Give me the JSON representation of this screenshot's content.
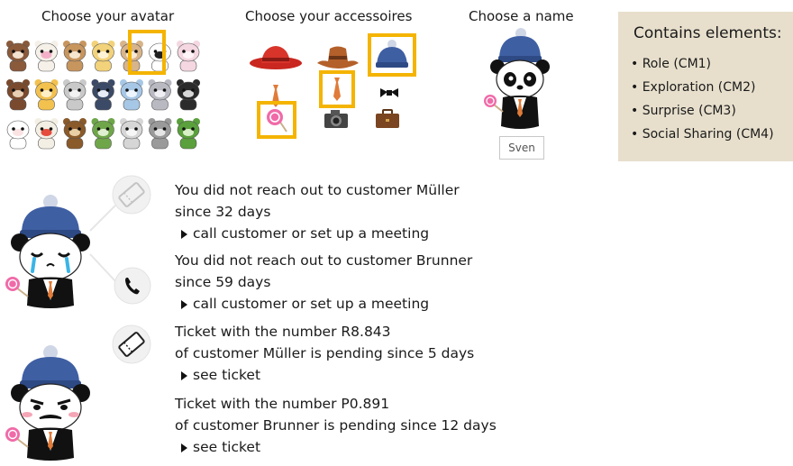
{
  "avatar_section": {
    "title": "Choose your avatar"
  },
  "accessory_section": {
    "title": "Choose your accessoires"
  },
  "name_section": {
    "title": "Choose a name",
    "name_value": "Sven"
  },
  "elements_panel": {
    "title": "Contains elements:",
    "items": [
      "• Role (CM1)",
      "• Exploration (CM2)",
      "• Surprise (CM3)",
      "• Social Sharing (CM4)"
    ]
  },
  "notifications": [
    {
      "line1": "You did not reach out to customer Müller",
      "line2": "since 32 days",
      "action": "call customer or set up a meeting"
    },
    {
      "line1": "You did not reach out to customer Brunner",
      "line2": "since 59 days",
      "action": "call customer or set up a meeting"
    },
    {
      "line1": "Ticket with the number R8.843",
      "line2": "of customer Müller is pending since 5 days",
      "action": "see ticket"
    },
    {
      "line1": "Ticket with the number P0.891",
      "line2": "of customer Brunner  is pending since 12 days",
      "action": "see ticket"
    }
  ],
  "colors": {
    "highlight": "#f4b400",
    "panel": "#e7dfcc",
    "hat": "#3f5fa3",
    "tie": "#e07b39"
  },
  "icons": [
    "ticket-icon",
    "phone-icon",
    "ticket-icon",
    "triangle-bullet-icon"
  ]
}
